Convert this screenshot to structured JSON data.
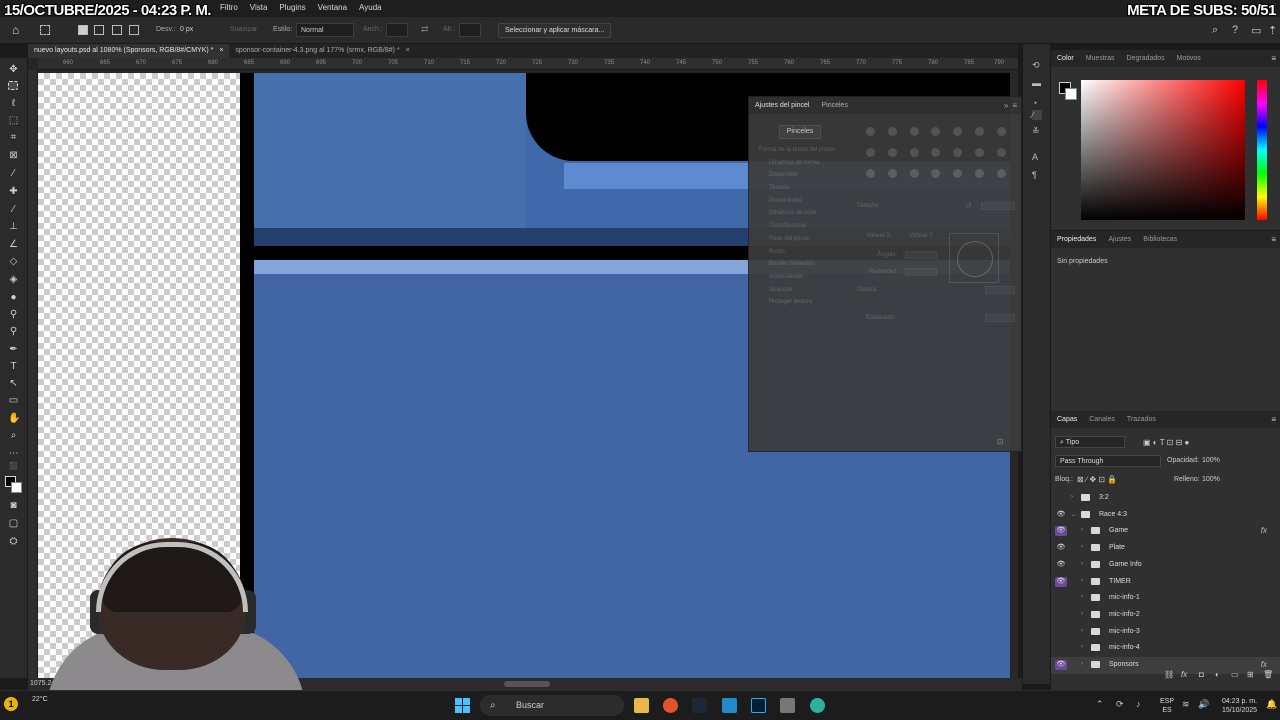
{
  "overlay": {
    "date": "15/OCTUBRE/2025 - 04:23 P. M.",
    "subs": "META DE SUBS: 50/51"
  },
  "menubar": {
    "items": [
      "Filtro",
      "Vista",
      "Plugins",
      "Ventana",
      "Ayuda"
    ]
  },
  "options": {
    "desv_label": "Desv.:",
    "desv_value": "0 px",
    "suavizar": "Suavizar",
    "estilo_label": "Estilo:",
    "estilo_value": "Normal",
    "anch_label": "Anch.:",
    "alt_label": "Alt.:",
    "mask_button": "Seleccionar y aplicar máscara..."
  },
  "tabs": [
    {
      "label": "nuevo layouts.psd al 1080% (Sponsors, RGB/8#/CMYK) *",
      "close": "×"
    },
    {
      "label": "sponsor-container-4.3.png al 177% (srmx, RGB/8#) *",
      "close": "×"
    }
  ],
  "ruler": [
    "660",
    "665",
    "670",
    "675",
    "680",
    "685",
    "690",
    "695",
    "700",
    "705",
    "710",
    "715",
    "720",
    "725",
    "730",
    "735",
    "740",
    "745",
    "750",
    "755",
    "760",
    "765",
    "770",
    "775",
    "780",
    "785",
    "790"
  ],
  "brush_panel": {
    "tabs": [
      "Ajustes del pincel",
      "Pinceles"
    ],
    "pinceles_button": "Pinceles",
    "items": [
      "Forma de la punta del pincel",
      "Dinámica de forma",
      "Dispersión",
      "Textura",
      "Pincel doble",
      "Dinámica de color",
      "Transferencia",
      "Pose del pincel",
      "Ruido",
      "Bordes húmedos",
      "Acumulación",
      "Suavizar",
      "Proteger textura"
    ],
    "tamano": "Tamaño",
    "voltear_x": "Voltear X",
    "voltear_y": "Voltear Y",
    "angulo": "Ángulo:",
    "redondez": "Redondez:",
    "dureza": "Dureza",
    "espaciado": "Espaciado"
  },
  "color_panel": {
    "tabs": [
      "Color",
      "Muestras",
      "Degradados",
      "Motivos"
    ]
  },
  "properties_panel": {
    "tabs": [
      "Propiedades",
      "Ajustes",
      "Bibliotecas"
    ],
    "empty": "Sin propiedades"
  },
  "layers_panel": {
    "tabs": [
      "Capas",
      "Canales",
      "Trazados"
    ],
    "filter": "Tipo",
    "blend_mode": "Pass Through",
    "opacity_label": "Opacidad:",
    "opacity_value": "100%",
    "lock_label": "Bloq.:",
    "fill_label": "Relleno:",
    "fill_value": "100%",
    "layers": [
      {
        "name": "3:2",
        "visible": false,
        "fx": false,
        "indent": 1,
        "expanded": false
      },
      {
        "name": "Race 4:3",
        "visible": true,
        "fx": false,
        "indent": 1,
        "expanded": true
      },
      {
        "name": "Game",
        "visible": true,
        "fx": true,
        "indent": 2,
        "expanded": false
      },
      {
        "name": "Plate",
        "visible": true,
        "fx": false,
        "indent": 2,
        "expanded": false
      },
      {
        "name": "Game Info",
        "visible": true,
        "fx": false,
        "indent": 2,
        "expanded": false
      },
      {
        "name": "TIMER",
        "visible": true,
        "fx": false,
        "indent": 2,
        "expanded": false
      },
      {
        "name": "mic-info-1",
        "visible": false,
        "fx": false,
        "indent": 2,
        "expanded": false
      },
      {
        "name": "mic-info-2",
        "visible": false,
        "fx": false,
        "indent": 2,
        "expanded": false
      },
      {
        "name": "mic-info-3",
        "visible": false,
        "fx": false,
        "indent": 2,
        "expanded": false
      },
      {
        "name": "mic-info-4",
        "visible": false,
        "fx": false,
        "indent": 2,
        "expanded": false
      },
      {
        "name": "Sponsors",
        "visible": true,
        "fx": true,
        "indent": 2,
        "expanded": false
      }
    ]
  },
  "status": {
    "zoom": "1075.24"
  },
  "taskbar": {
    "badge": "1",
    "temp": "22°C",
    "search": "Buscar",
    "lang_top": "ESP",
    "lang_bottom": "ES",
    "time": "04:23 p. m.",
    "date": "15/10/2025"
  }
}
